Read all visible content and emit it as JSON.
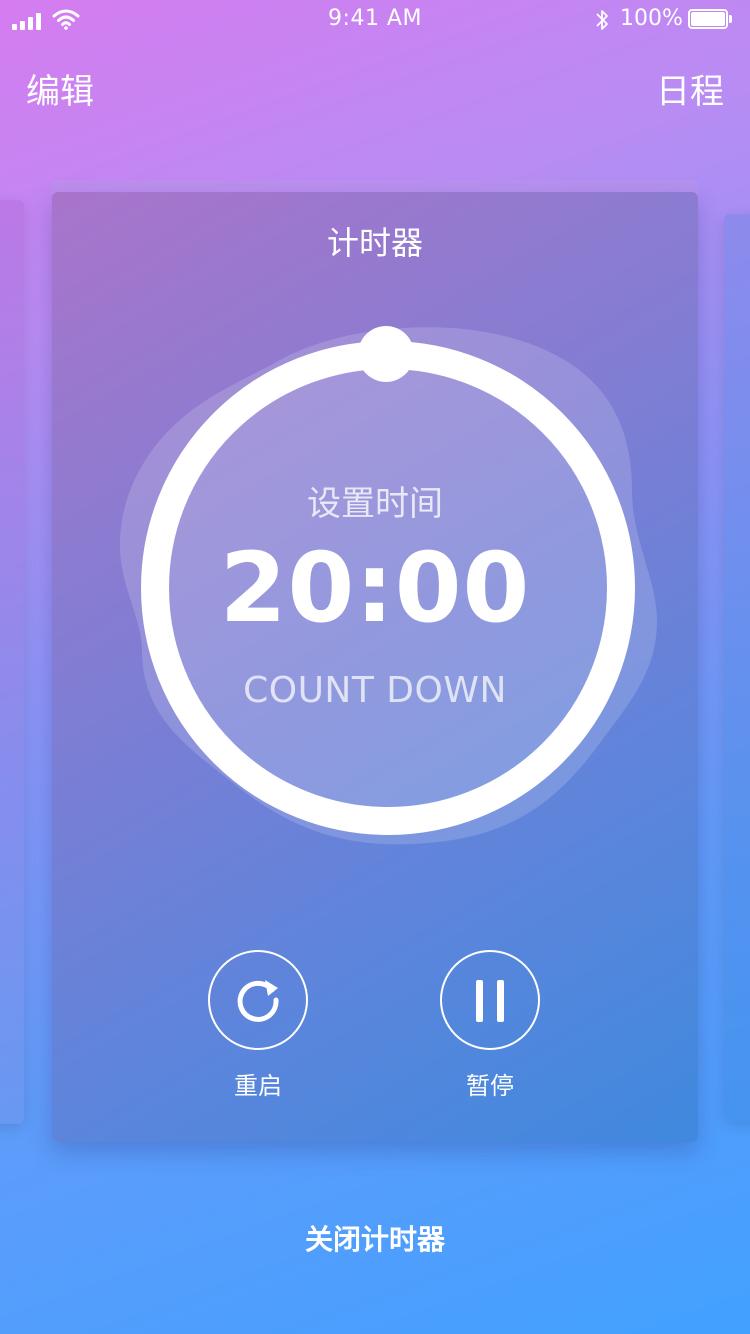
{
  "status_bar": {
    "time": "9:41 AM",
    "battery_percent": "100%",
    "battery_level": 1.0,
    "icons": [
      "signal-icon",
      "wifi-icon",
      "bluetooth-icon",
      "battery-icon"
    ]
  },
  "nav": {
    "left_label": "编辑",
    "right_label": "日程"
  },
  "card": {
    "title": "计时器",
    "ring_label": "设置时间",
    "time": "20:00",
    "subtitle": "COUNT DOWN",
    "restart_label": "重启",
    "restart_icon": "restart-icon",
    "pause_label": "暂停",
    "pause_icon": "pause-icon"
  },
  "footer": {
    "close_label": "关闭计时器"
  },
  "colors": {
    "accent": "#ffffff",
    "bg_top": "#d57cf0",
    "bg_bottom": "#42a0ff"
  }
}
